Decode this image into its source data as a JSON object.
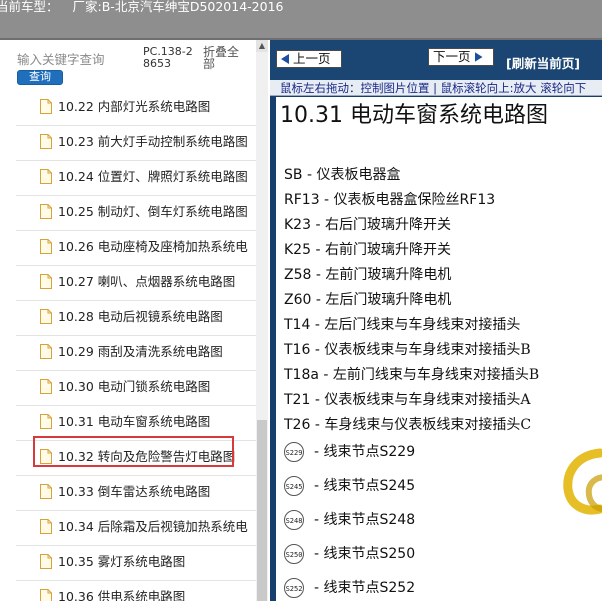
{
  "header": {
    "prefix": "当前车型：",
    "vehicle": "厂家:B-北京汽车绅宝D502014-2016"
  },
  "sidebar": {
    "search_placeholder": "输入关键字查询",
    "search_button": "查询",
    "pc_code": "PC.138-28653",
    "collapse_all": "折叠全部",
    "items": [
      {
        "label": "10.22  内部灯光系统电路图"
      },
      {
        "label": "10.23  前大灯手动控制系统电路图"
      },
      {
        "label": "10.24  位置灯、牌照灯系统电路图"
      },
      {
        "label": "10.25  制动灯、倒车灯系统电路图"
      },
      {
        "label": "10.26  电动座椅及座椅加热系统电"
      },
      {
        "label": "10.27  喇叭、点烟器系统电路图"
      },
      {
        "label": "10.28  电动后视镜系统电路图"
      },
      {
        "label": "10.29  雨刮及清洗系统电路图"
      },
      {
        "label": "10.30  电动门锁系统电路图"
      },
      {
        "label": "10.31  电动车窗系统电路图"
      },
      {
        "label": "10.32  转向及危险警告灯电路图"
      },
      {
        "label": "10.33  倒车雷达系统电路图"
      },
      {
        "label": "10.34  后除霜及后视镜加热系统电"
      },
      {
        "label": "10.35  雾灯系统电路图"
      },
      {
        "label": "10.36  供电系统电路图"
      }
    ]
  },
  "viewer": {
    "prev_button": "上一页",
    "next_button": "下一页",
    "refresh_button": "[刷新当前页]",
    "hint": "鼠标左右拖动：控制图片位置 | 鼠标滚轮向上:放大  滚轮向下",
    "page_title": "10.31  电动车窗系统电路图",
    "legend": [
      {
        "code": "SB -",
        "desc": "仪表板电器盒"
      },
      {
        "code": "RF13 -",
        "desc": "仪表板电器盒保险丝RF13"
      },
      {
        "code": "K23 -",
        "desc": "右后门玻璃升降开关"
      },
      {
        "code": "K25 -",
        "desc": "右前门玻璃升降开关"
      },
      {
        "code": "Z58 -",
        "desc": "左前门玻璃升降电机"
      },
      {
        "code": "Z60 -",
        "desc": "左后门玻璃升降电机"
      },
      {
        "code": "T14 -",
        "desc": "左后门线束与车身线束对接插头"
      },
      {
        "code": "T16 -",
        "desc": "仪表板线束与车身线束对接插头B"
      },
      {
        "code": "T18a -",
        "desc": "左前门线束与车身线束对接插头B"
      },
      {
        "code": "T21 -",
        "desc": "仪表板线束与车身线束对接插头A"
      },
      {
        "code": "T26 -",
        "desc": "车身线束与仪表板线束对接插头C"
      }
    ],
    "splices": [
      {
        "badge": "S229",
        "text": "-  线束节点S229"
      },
      {
        "badge": "S245",
        "text": "-  线束节点S245"
      },
      {
        "badge": "S248",
        "text": "-  线束节点S248"
      },
      {
        "badge": "S250",
        "text": "-  线束节点S250"
      },
      {
        "badge": "S252",
        "text": "-  线束节点S252"
      }
    ]
  },
  "colors": {
    "header_bg": "#8e8e8e",
    "viewer_bg": "#163f6e",
    "search_button_bg": "#1f6fbd",
    "highlight": "#d63a3a"
  }
}
